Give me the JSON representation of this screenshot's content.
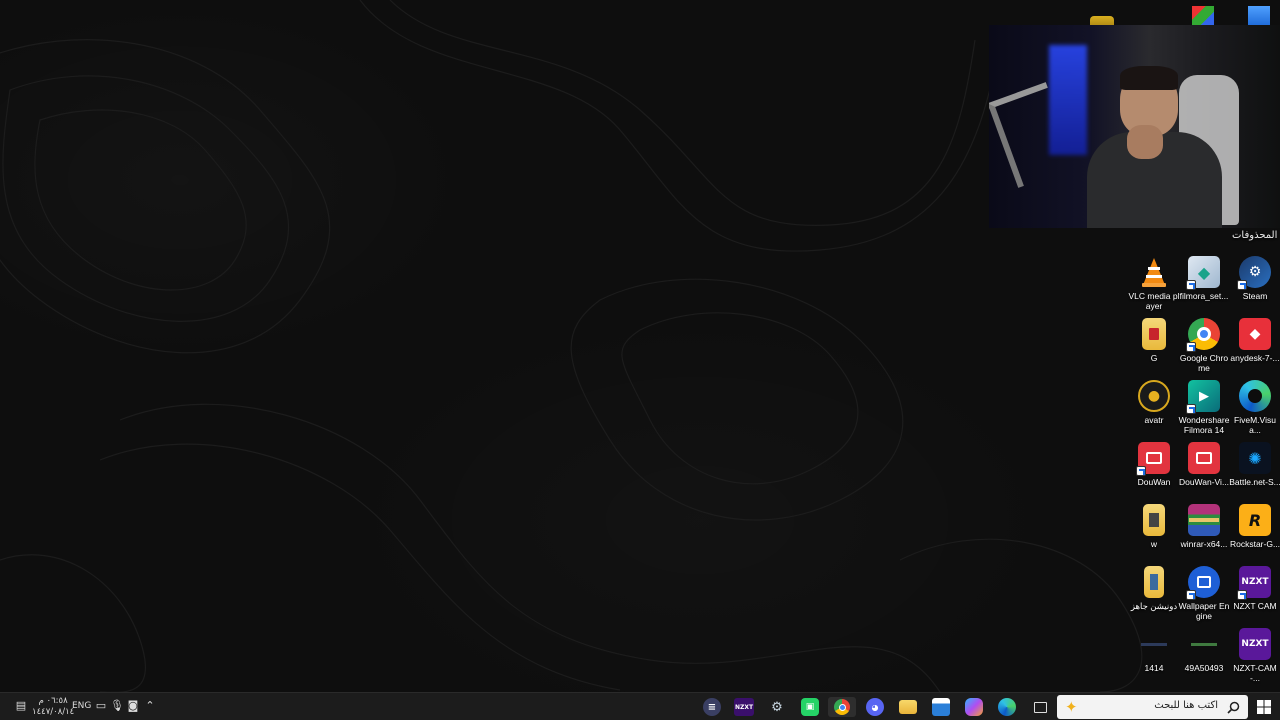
{
  "desktop": {
    "folder_label": "المحذوفات",
    "icons": [
      {
        "label": "VLC media player",
        "icon": "vlc-icon"
      },
      {
        "label": "filmora_set...",
        "icon": "filmora-setup-icon"
      },
      {
        "label": "Steam",
        "icon": "steam-icon"
      },
      {
        "label": "G",
        "icon": "folder-icon"
      },
      {
        "label": "Google Chrome",
        "icon": "chrome-icon"
      },
      {
        "label": "anydesk-7-...",
        "icon": "anydesk-icon"
      },
      {
        "label": "avatr",
        "icon": "avatr-icon"
      },
      {
        "label": "Wondershare Filmora 14",
        "icon": "filmora-icon"
      },
      {
        "label": "FiveM.Visua...",
        "icon": "edge-file-icon"
      },
      {
        "label": "DouWan",
        "icon": "douwan-icon"
      },
      {
        "label": "DouWan-Vi...",
        "icon": "douwan-installer-icon"
      },
      {
        "label": "Battle.net-S...",
        "icon": "battlenet-icon"
      },
      {
        "label": "w",
        "icon": "folder-icon"
      },
      {
        "label": "winrar-x64...",
        "icon": "winrar-icon"
      },
      {
        "label": "Rockstar-G...",
        "icon": "rockstar-icon"
      },
      {
        "label": "دونيشن جاهز",
        "icon": "folder-icon"
      },
      {
        "label": "Wallpaper Engine",
        "icon": "wallpaper-engine-icon"
      },
      {
        "label": "NZXT CAM",
        "icon": "nzxt-cam-icon"
      },
      {
        "label": "1414",
        "icon": "image-file-icon"
      },
      {
        "label": "49A50493",
        "icon": "image-file-icon"
      },
      {
        "label": "NZXT-CAM-...",
        "icon": "nzxt-installer-icon"
      }
    ]
  },
  "taskbar": {
    "search_placeholder": "اكتب هنا للبحث",
    "language": "ENG",
    "time": "٠٦:٥٨ م",
    "date": "١٤٤٧/٠٨/١٤",
    "pinned": [
      {
        "name": "task-view",
        "icon": "task-view-icon"
      },
      {
        "name": "edge",
        "icon": "edge-icon"
      },
      {
        "name": "copilot",
        "icon": "copilot-icon"
      },
      {
        "name": "microsoft-store",
        "icon": "store-icon"
      },
      {
        "name": "file-explorer",
        "icon": "folder-icon"
      },
      {
        "name": "discord",
        "icon": "discord-icon"
      },
      {
        "name": "chrome",
        "icon": "chrome-icon"
      },
      {
        "name": "whatsapp",
        "icon": "whatsapp-icon"
      },
      {
        "name": "steam",
        "icon": "steam-icon"
      },
      {
        "name": "nzxt",
        "icon": "nzxt-icon"
      },
      {
        "name": "app",
        "icon": "app-icon"
      }
    ],
    "nzxt_label": "NZXT"
  },
  "colors": {
    "desktop_bg": "#0e0e0e",
    "taskbar_bg": "#1c1c1c",
    "search_bg": "#f3f3f3"
  }
}
